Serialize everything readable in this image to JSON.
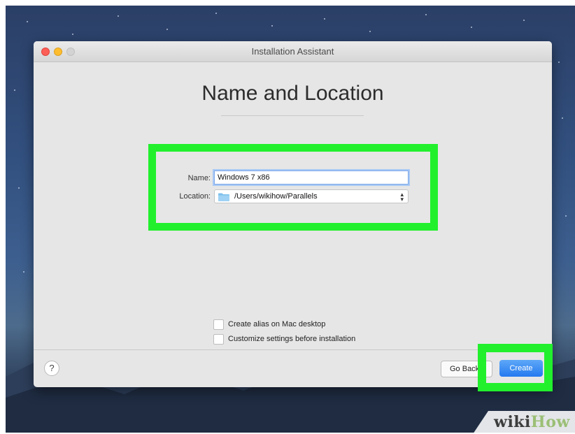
{
  "window": {
    "title": "Installation Assistant"
  },
  "page": {
    "title": "Name and Location"
  },
  "form": {
    "name_label": "Name:",
    "name_value": "Windows 7 x86",
    "location_label": "Location:",
    "location_value": "/Users/wikihow/Parallels",
    "location_icon": "folder-icon"
  },
  "options": [
    {
      "label": "Create alias on Mac desktop",
      "checked": false
    },
    {
      "label": "Customize settings before installation",
      "checked": false
    }
  ],
  "footer": {
    "help_label": "?",
    "go_back_label": "Go Back",
    "create_label": "Create"
  },
  "watermark": {
    "part1": "wiki",
    "part2": "How"
  },
  "colors": {
    "highlight": "#22f02d",
    "primary_button": "#2479ef",
    "traffic_close": "#fc5f57",
    "traffic_minimize": "#fdbd2e"
  }
}
